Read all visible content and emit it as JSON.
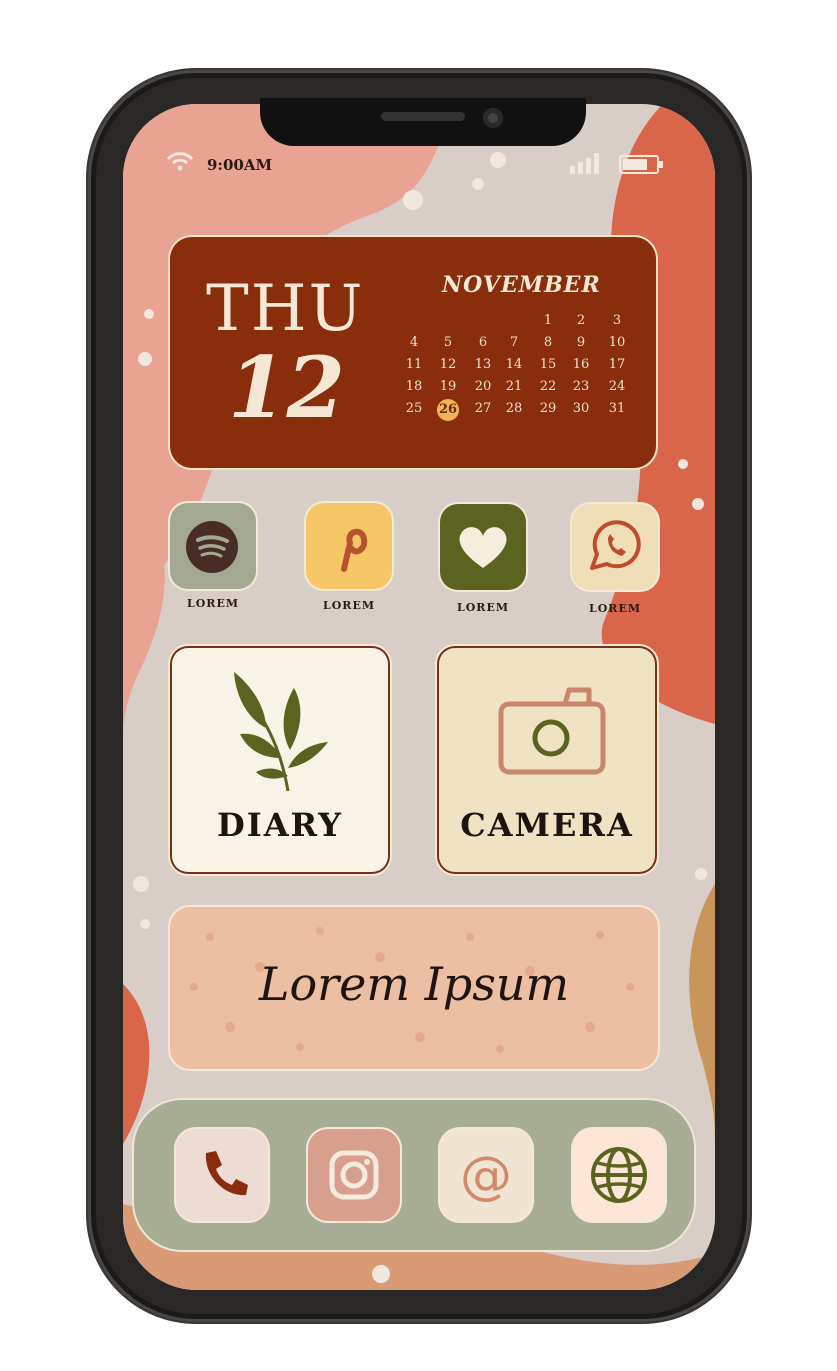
{
  "status_bar": {
    "time": "9:00AM",
    "wifi_icon": "wifi-icon",
    "signal_icon": "signal-bars-icon",
    "battery_icon": "battery-icon"
  },
  "calendar_widget": {
    "day_name": "THU",
    "day_number": "12",
    "month": "NOVEMBER",
    "rows": [
      [
        "",
        "",
        "",
        "",
        "1",
        "2",
        "3"
      ],
      [
        "4",
        "5",
        "6",
        "7",
        "8",
        "9",
        "10"
      ],
      [
        "11",
        "12",
        "13",
        "14",
        "15",
        "16",
        "17"
      ],
      [
        "18",
        "19",
        "20",
        "21",
        "22",
        "23",
        "24"
      ],
      [
        "25",
        "26",
        "27",
        "28",
        "29",
        "30",
        "31"
      ]
    ],
    "highlighted_day": "26",
    "colors": {
      "background": "#8a2d0c",
      "highlight": "#f2b45a"
    }
  },
  "app_row": [
    {
      "label": "LOREM",
      "icon": "spotify-icon",
      "bg": "#a3a893"
    },
    {
      "label": "LOREM",
      "icon": "pinterest-icon",
      "bg": "#f6c667"
    },
    {
      "label": "LOREM",
      "icon": "heart-icon",
      "bg": "#5a6420"
    },
    {
      "label": "LOREM",
      "icon": "whatsapp-icon",
      "bg": "#f0dfb6"
    }
  ],
  "widgets": {
    "diary": {
      "label": "DIARY",
      "icon": "leaf-icon",
      "bg": "#f7f3e6"
    },
    "camera": {
      "label": "CAMERA",
      "icon": "camera-icon",
      "bg": "#f0e3c3"
    },
    "lorem": {
      "text": "Lorem Ipsum",
      "bg": "#ecbfa3"
    }
  },
  "dock": [
    {
      "icon": "phone-icon",
      "bg": "#ecdcd3"
    },
    {
      "icon": "instagram-icon",
      "bg": "#d8a08c"
    },
    {
      "icon": "at-sign-icon",
      "bg": "#f0e4d3"
    },
    {
      "icon": "globe-icon",
      "bg": "#fde6d6"
    }
  ]
}
